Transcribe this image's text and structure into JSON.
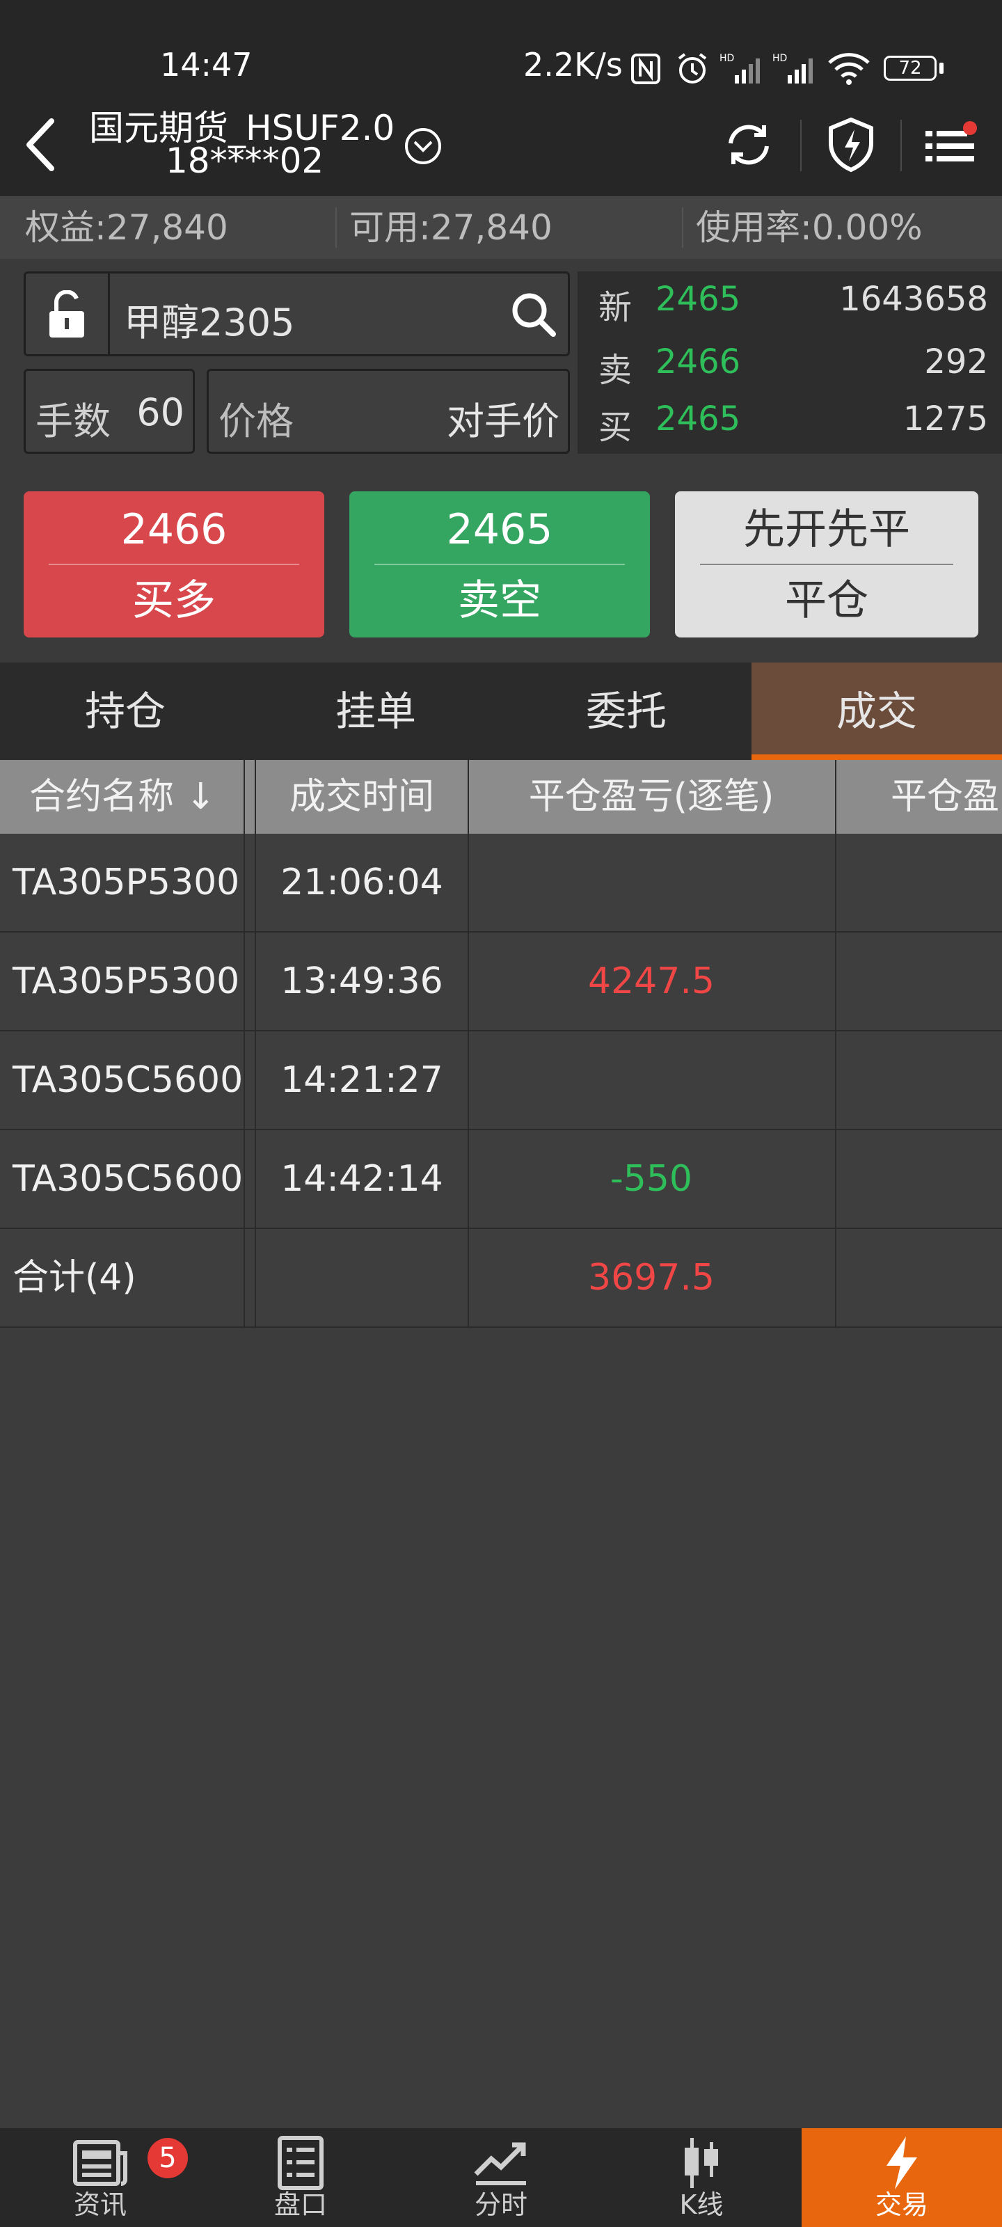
{
  "status": {
    "time": "14:47",
    "net_speed": "2.2K/s",
    "battery": "72"
  },
  "header": {
    "account_name": "国元期货_HSUF2.0",
    "account_id": "18****02"
  },
  "account": {
    "equity": "权益:27,840",
    "available": "可用:27,840",
    "usage": "使用率:0.00%"
  },
  "order": {
    "symbol": "甲醇2305",
    "qty_label": "手数",
    "qty_value": "60",
    "price_label": "价格",
    "price_type": "对手价"
  },
  "quote": {
    "rows": [
      {
        "label": "新",
        "price": "2465",
        "volume": "1643658"
      },
      {
        "label": "卖",
        "price": "2466",
        "volume": "292"
      },
      {
        "label": "买",
        "price": "2465",
        "volume": "1275"
      }
    ]
  },
  "actions": {
    "buy_price": "2466",
    "buy_label": "买多",
    "sell_price": "2465",
    "sell_label": "卖空",
    "close_mode": "先开先平",
    "close_label": "平仓"
  },
  "tabs": [
    "持仓",
    "挂单",
    "委托",
    "成交"
  ],
  "table": {
    "headers": [
      "合约名称 ↓",
      "成交时间",
      "平仓盈亏(逐笔)",
      "平仓盈"
    ],
    "rows": [
      {
        "contract": "TA305P5300",
        "time": "21:06:04",
        "pnl": ""
      },
      {
        "contract": "TA305P5300",
        "time": "13:49:36",
        "pnl": "4247.5"
      },
      {
        "contract": "TA305C5600",
        "time": "14:21:27",
        "pnl": ""
      },
      {
        "contract": "TA305C5600",
        "time": "14:42:14",
        "pnl": "-550"
      }
    ],
    "total_label": "合计(4)",
    "total_pnl": "3697.5"
  },
  "nav": {
    "items": [
      "资讯",
      "盘口",
      "分时",
      "K线",
      "交易"
    ],
    "badge": "5"
  },
  "colors": {
    "buy": "#d8474b",
    "sell": "#34a661",
    "accent": "#e8670e",
    "profit": "#f04646",
    "loss": "#2fbf5a"
  }
}
